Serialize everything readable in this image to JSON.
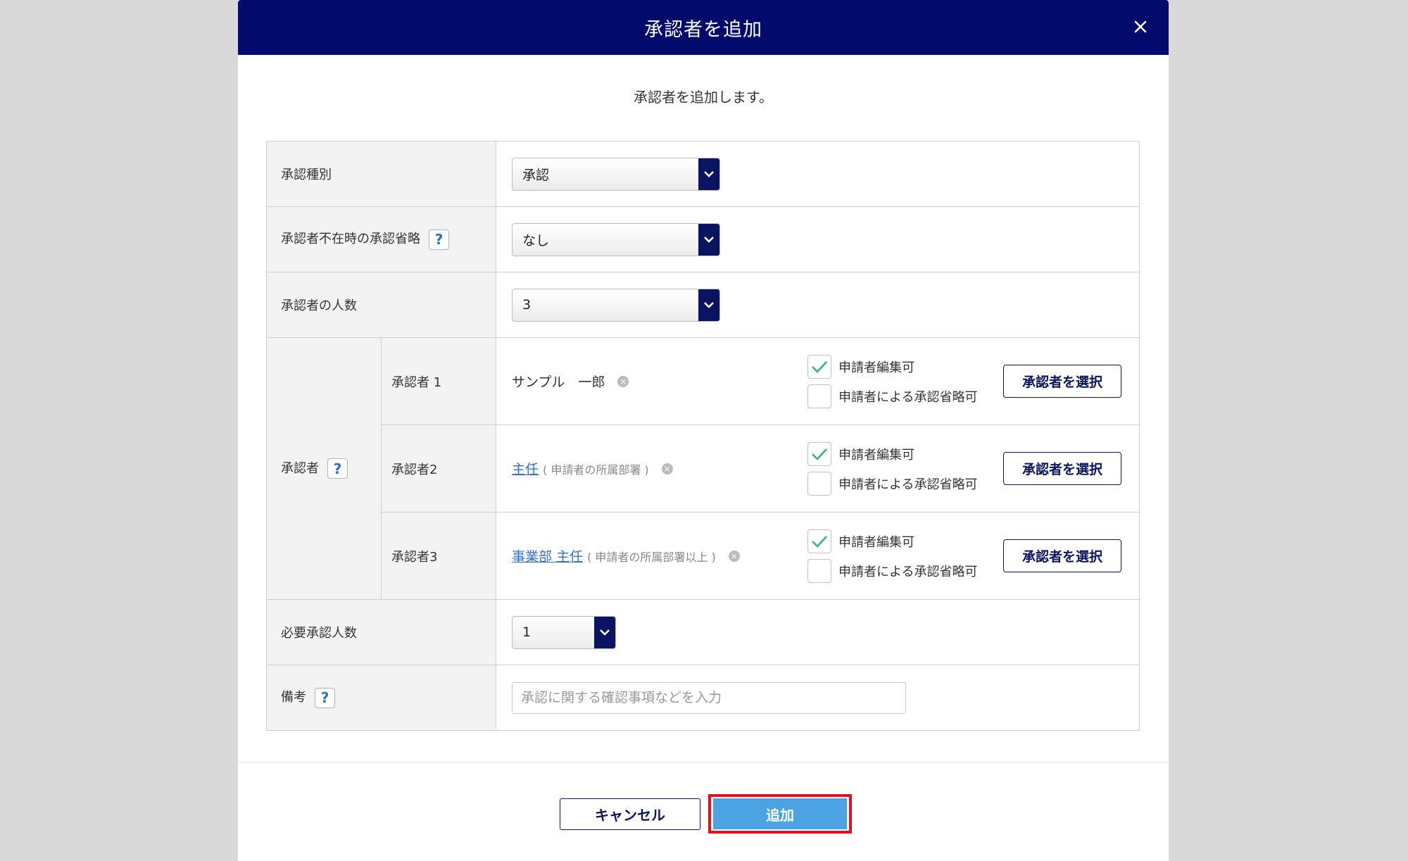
{
  "dialog": {
    "title": "承認者を追加",
    "intro": "承認者を追加します。"
  },
  "rows": {
    "approval_type": {
      "label": "承認種別",
      "value": "承認"
    },
    "absence_skip": {
      "label": "承認者不在時の承認省略",
      "value": "なし"
    },
    "approver_count": {
      "label": "承認者の人数",
      "value": "3"
    },
    "approvers": {
      "label": "承認者",
      "items": [
        {
          "label": "承認者 1",
          "name": "サンプル　一郎",
          "link": "",
          "note": "",
          "edit_label": "申請者編集可",
          "edit_checked": true,
          "skip_label": "申請者による承認省略可",
          "skip_checked": false,
          "button": "承認者を選択"
        },
        {
          "label": "承認者2",
          "name": "",
          "link": "主任",
          "note": "( 申請者の所属部署 )",
          "edit_label": "申請者編集可",
          "edit_checked": true,
          "skip_label": "申請者による承認省略可",
          "skip_checked": false,
          "button": "承認者を選択"
        },
        {
          "label": "承認者3",
          "name": "",
          "link": "事業部 主任",
          "note": "( 申請者の所属部署以上 )",
          "edit_label": "申請者編集可",
          "edit_checked": true,
          "skip_label": "申請者による承認省略可",
          "skip_checked": false,
          "button": "承認者を選択"
        }
      ]
    },
    "required_count": {
      "label": "必要承認人数",
      "value": "1"
    },
    "memo": {
      "label": "備考",
      "placeholder": "承認に関する確認事項などを入力"
    }
  },
  "buttons": {
    "cancel": "キャンセル",
    "add": "追加"
  },
  "colors": {
    "header_bg": "#020b6b",
    "accent": "#0b1460",
    "link": "#2e6fce",
    "add_button": "#4ba3e3",
    "highlight": "#e4101e",
    "check": "#3cb371"
  }
}
